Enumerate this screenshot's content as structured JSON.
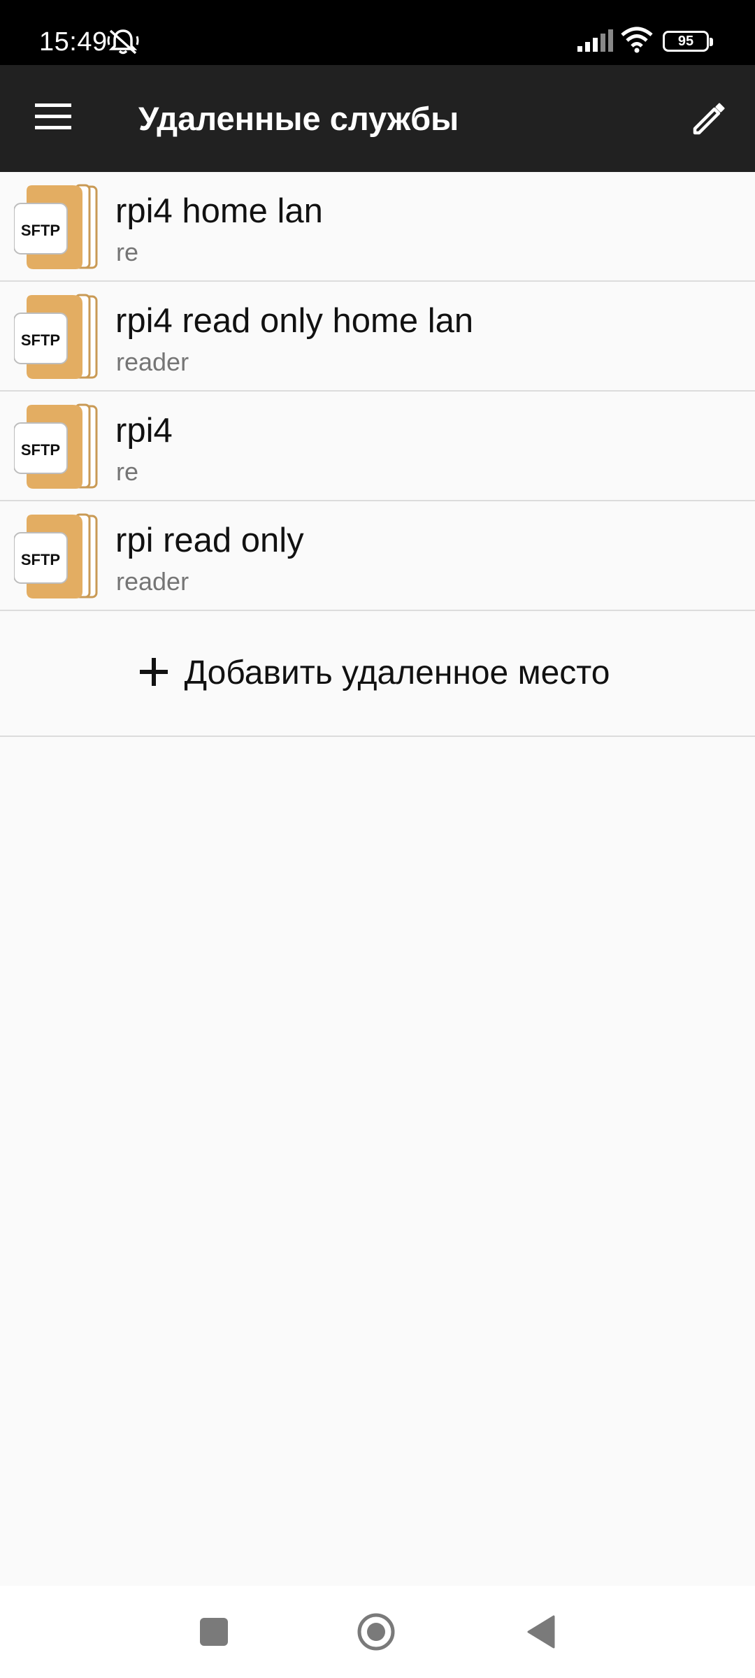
{
  "status_bar": {
    "time": "15:49",
    "battery": "95",
    "icons": [
      "mute-icon",
      "signal-icon",
      "wifi-icon",
      "battery-icon"
    ]
  },
  "app_bar": {
    "title": "Удаленные службы",
    "icons": [
      "menu-icon",
      "edit-pencil-icon"
    ]
  },
  "services": [
    {
      "icon_label": "SFTP",
      "title": "rpi4 home lan",
      "subtitle": "re"
    },
    {
      "icon_label": "SFTP",
      "title": "rpi4 read only home lan",
      "subtitle": "reader"
    },
    {
      "icon_label": "SFTP",
      "title": "rpi4",
      "subtitle": "re"
    },
    {
      "icon_label": "SFTP",
      "title": "rpi read only",
      "subtitle": "reader"
    }
  ],
  "add_remote": {
    "label": "Добавить удаленное место",
    "icon": "plus-icon"
  },
  "nav_bar": {
    "icons": [
      "recent-apps-icon",
      "home-icon",
      "back-icon"
    ]
  },
  "colors": {
    "app_bar": "#212121",
    "folder": "#e3ad62",
    "background": "#fafafa",
    "divider": "#dcdcdc"
  }
}
